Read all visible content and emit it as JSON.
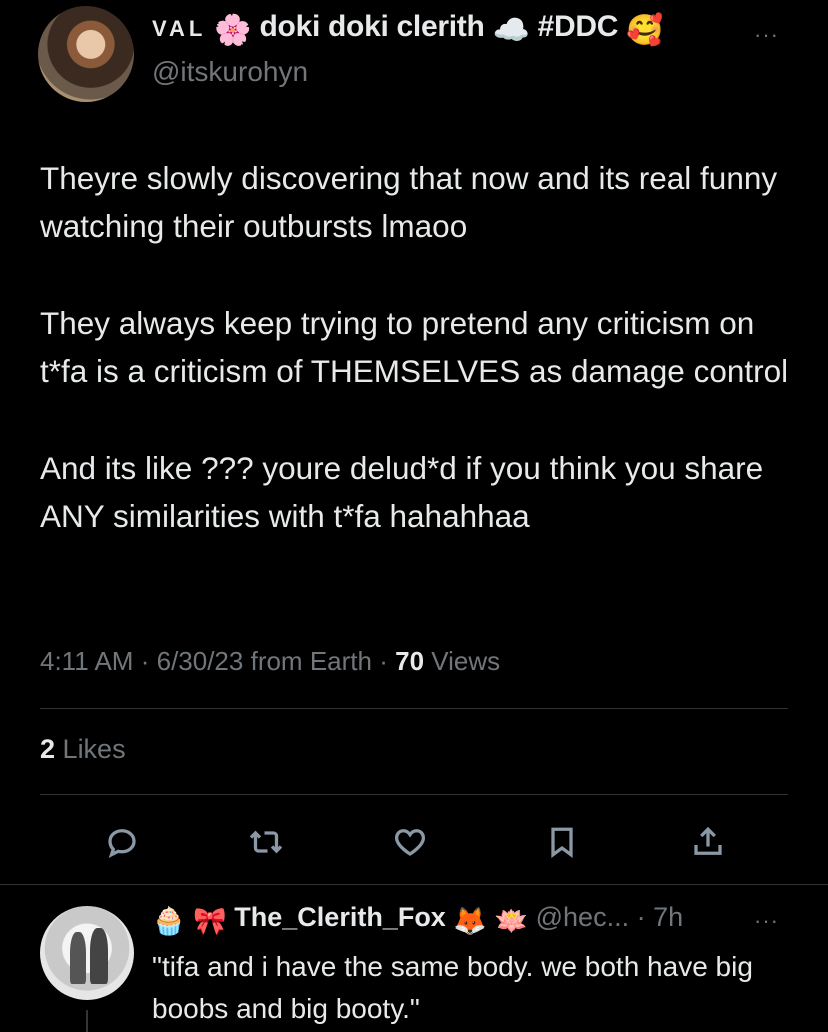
{
  "tweet": {
    "author": {
      "name_prefix": "VAL",
      "name_emoji_1": "🌸",
      "name_main": "doki doki clerith",
      "name_emoji_2": "☁️",
      "name_tag": "#DDC",
      "name_emoji_3": "🥰",
      "handle": "@itskurohyn"
    },
    "more_label": "···",
    "body": [
      "Theyre slowly discovering that now and its real funny watching their outbursts lmaoo",
      "They always keep trying to pretend any criticism on t*fa is a criticism of THEMSELVES as damage control",
      "And its like ??? youre delud*d if you think you share ANY similarities with t*fa hahahhaa"
    ],
    "meta": {
      "time": "4:11 AM",
      "date": "6/30/23",
      "source": "from Earth",
      "views_count": "70",
      "views_label": "Views",
      "sep": "·"
    },
    "likes": {
      "count": "2",
      "label": "Likes"
    },
    "actions": [
      "reply-icon",
      "retweet-icon",
      "like-icon",
      "bookmark-icon",
      "share-icon"
    ]
  },
  "reply": {
    "emoji_1": "🧁",
    "emoji_2": "🎀",
    "name": "The_Clerith_Fox",
    "emoji_3": "🦊",
    "emoji_4": "🪷",
    "handle": "@hec...",
    "sep": "·",
    "time": "7h",
    "more_label": "···",
    "body": "\"tifa and i have the same body. we both have big boobs and big booty.\""
  }
}
